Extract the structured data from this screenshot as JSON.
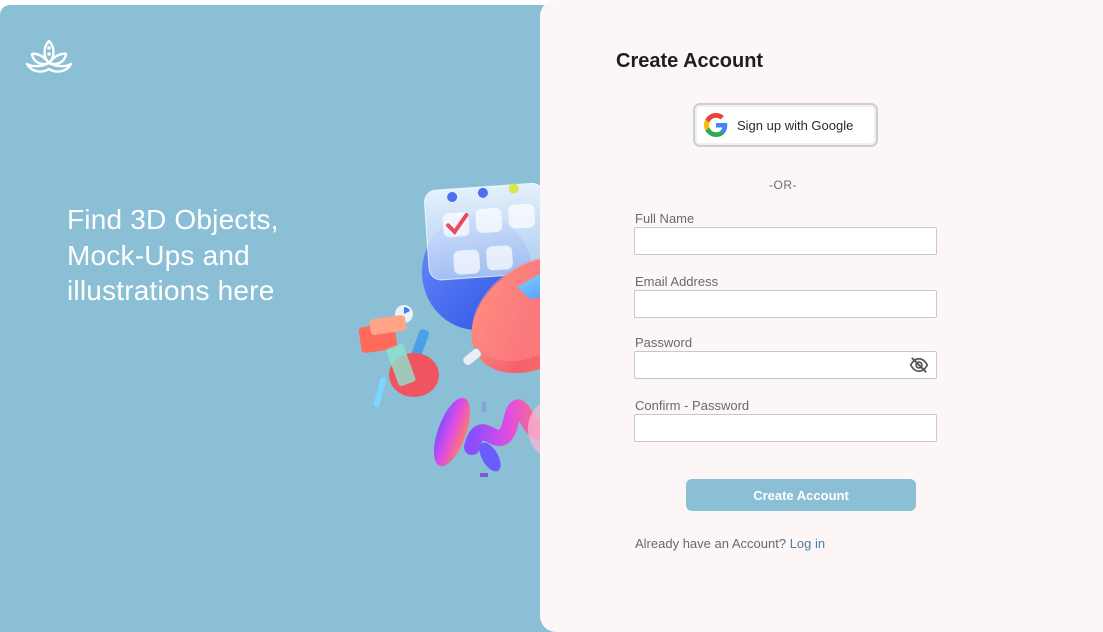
{
  "colors": {
    "brand": "#8abfd6",
    "panel_bg": "#fcf6f6",
    "link": "#4a7fa8"
  },
  "hero": {
    "logo_icon": "lotus-icon",
    "tagline_lines": [
      "Find 3D Objects,",
      "Mock-Ups and",
      "illustrations here"
    ],
    "illustration": "3d-calendar-clock-abstract-illustration"
  },
  "form": {
    "title": "Create Account",
    "google_button": {
      "label": "Sign up with Google",
      "icon": "google-g-icon"
    },
    "separator": "-OR-",
    "fields": {
      "full_name": {
        "label": "Full Name",
        "value": ""
      },
      "email": {
        "label": "Email Address",
        "value": ""
      },
      "password": {
        "label": "Password",
        "value": "",
        "toggle_icon": "eye-slash-icon"
      },
      "confirm_password": {
        "label": "Confirm - Password",
        "value": ""
      }
    },
    "submit_label": "Create Account",
    "login_prompt": "Already have an Account?",
    "login_link": "Log in"
  }
}
